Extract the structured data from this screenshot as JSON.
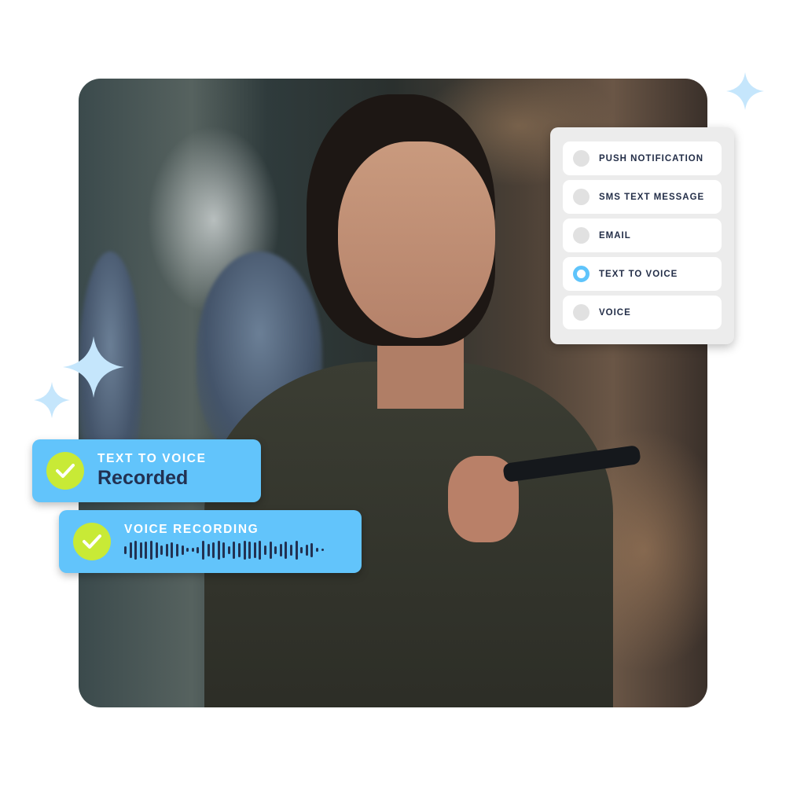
{
  "delivery_options": {
    "items": [
      {
        "label": "PUSH NOTIFICATION",
        "selected": false
      },
      {
        "label": "SMS TEXT MESSAGE",
        "selected": false
      },
      {
        "label": "EMAIL",
        "selected": false
      },
      {
        "label": "TEXT TO VOICE",
        "selected": true
      },
      {
        "label": "VOICE",
        "selected": false
      }
    ],
    "selected_color": "#5fc4fb"
  },
  "status_badges": {
    "text_to_voice": {
      "title": "TEXT TO VOICE",
      "status": "Recorded",
      "icon": "checkmark-icon"
    },
    "voice_recording": {
      "title": "VOICE RECORDING",
      "icon": "checkmark-icon",
      "waveform_icon": "audio-waveform-icon"
    }
  },
  "colors": {
    "badge_background": "#62c4fb",
    "check_circle": "#c8ea36",
    "text_dark": "#223152",
    "sparkle": "#c5e6fc"
  },
  "photo": {
    "description": "Smiling woman holding a smartphone in an office"
  }
}
